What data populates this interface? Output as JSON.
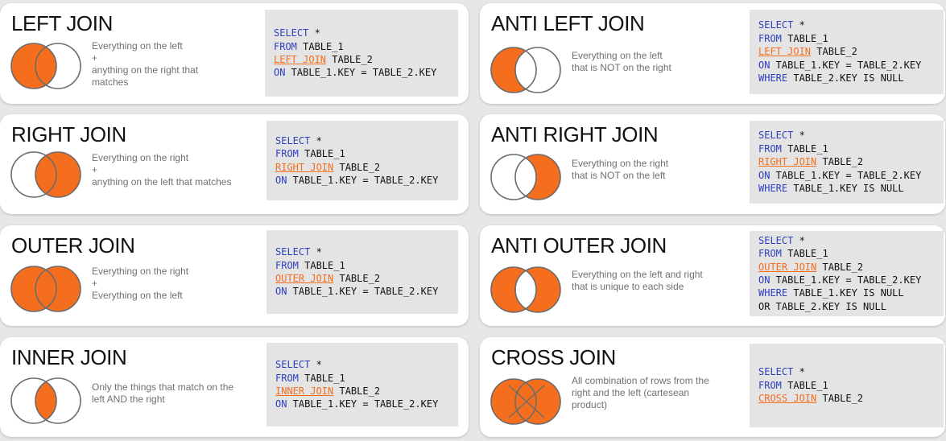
{
  "cards": [
    {
      "title": "LEFT JOIN",
      "venn": "left",
      "description": "Everything on the left\n+\nanything on the right that\nmatches",
      "sql": [
        {
          "kw": "SELECT",
          "rest": " *"
        },
        {
          "kw": "FROM",
          "rest": " TABLE_1"
        },
        {
          "join": "LEFT JOIN",
          "rest": " TABLE_2"
        },
        {
          "kw": "ON",
          "rest": " TABLE_1.KEY = TABLE_2.KEY"
        }
      ]
    },
    {
      "title": "ANTI LEFT JOIN",
      "venn": "anti-left",
      "description": "Everything on the left\nthat is NOT on the right",
      "sql": [
        {
          "kw": "SELECT",
          "rest": " *"
        },
        {
          "kw": "FROM",
          "rest": " TABLE_1"
        },
        {
          "join": "LEFT JOIN",
          "rest": " TABLE_2"
        },
        {
          "kw": "ON",
          "rest": " TABLE_1.KEY = TABLE_2.KEY"
        },
        {
          "kw": "WHERE",
          "rest": " TABLE_2.KEY IS NULL"
        }
      ]
    },
    {
      "title": "RIGHT JOIN",
      "venn": "right",
      "description": "Everything on the right\n+\nanything on the left that matches",
      "sql": [
        {
          "kw": "SELECT",
          "rest": " *"
        },
        {
          "kw": "FROM",
          "rest": " TABLE_1"
        },
        {
          "join": "RIGHT JOIN",
          "rest": " TABLE_2"
        },
        {
          "kw": "ON",
          "rest": " TABLE_1.KEY = TABLE_2.KEY"
        }
      ]
    },
    {
      "title": "ANTI RIGHT JOIN",
      "venn": "anti-right",
      "description": "Everything on the right\nthat is NOT on the left",
      "sql": [
        {
          "kw": "SELECT",
          "rest": " *"
        },
        {
          "kw": "FROM",
          "rest": " TABLE_1"
        },
        {
          "join": "RIGHT JOIN",
          "rest": " TABLE_2"
        },
        {
          "kw": "ON",
          "rest": " TABLE_1.KEY = TABLE_2.KEY"
        },
        {
          "kw": "WHERE",
          "rest": " TABLE_1.KEY IS NULL"
        }
      ]
    },
    {
      "title": "OUTER JOIN",
      "venn": "outer",
      "description": "Everything on the right\n+\nEverything on the left",
      "sql": [
        {
          "kw": "SELECT",
          "rest": " *"
        },
        {
          "kw": "FROM",
          "rest": " TABLE_1"
        },
        {
          "join": "OUTER JOIN",
          "rest": " TABLE_2"
        },
        {
          "kw": "ON",
          "rest": " TABLE_1.KEY = TABLE_2.KEY"
        }
      ]
    },
    {
      "title": "ANTI OUTER JOIN",
      "venn": "anti-outer",
      "description": "Everything on the left and right\nthat is unique to each side",
      "sql": [
        {
          "kw": "SELECT",
          "rest": " *"
        },
        {
          "kw": "FROM",
          "rest": " TABLE_1"
        },
        {
          "join": "OUTER JOIN",
          "rest": " TABLE_2"
        },
        {
          "kw": "ON",
          "rest": " TABLE_1.KEY = TABLE_2.KEY"
        },
        {
          "kw": "WHERE",
          "rest": " TABLE_1.KEY IS NULL"
        },
        {
          "plain": "OR TABLE_2.KEY IS NULL"
        }
      ]
    },
    {
      "title": "INNER JOIN",
      "venn": "inner",
      "description": "Only the things that match on the\nleft AND the right",
      "sql": [
        {
          "kw": "SELECT",
          "rest": " *"
        },
        {
          "kw": "FROM",
          "rest": " TABLE_1"
        },
        {
          "join": "INNER JOIN",
          "rest": " TABLE_2"
        },
        {
          "kw": "ON",
          "rest": " TABLE_1.KEY = TABLE_2.KEY"
        }
      ]
    },
    {
      "title": "CROSS JOIN",
      "venn": "cross",
      "description": "All combination of rows from the\nright and the left (cartesean\nproduct)",
      "sql": [
        {
          "kw": "SELECT",
          "rest": " *"
        },
        {
          "kw": "FROM",
          "rest": " TABLE_1"
        },
        {
          "join": "CROSS JOIN",
          "rest": " TABLE_2"
        }
      ]
    }
  ],
  "colors": {
    "fill": "#f56e1e",
    "stroke": "#6b6b6b",
    "keyword": "#2d3fbf",
    "join_keyword": "#f56e1e",
    "code_background": "#e4e4e4",
    "card_background": "#ffffff",
    "page_background": "#e7e7e7"
  }
}
